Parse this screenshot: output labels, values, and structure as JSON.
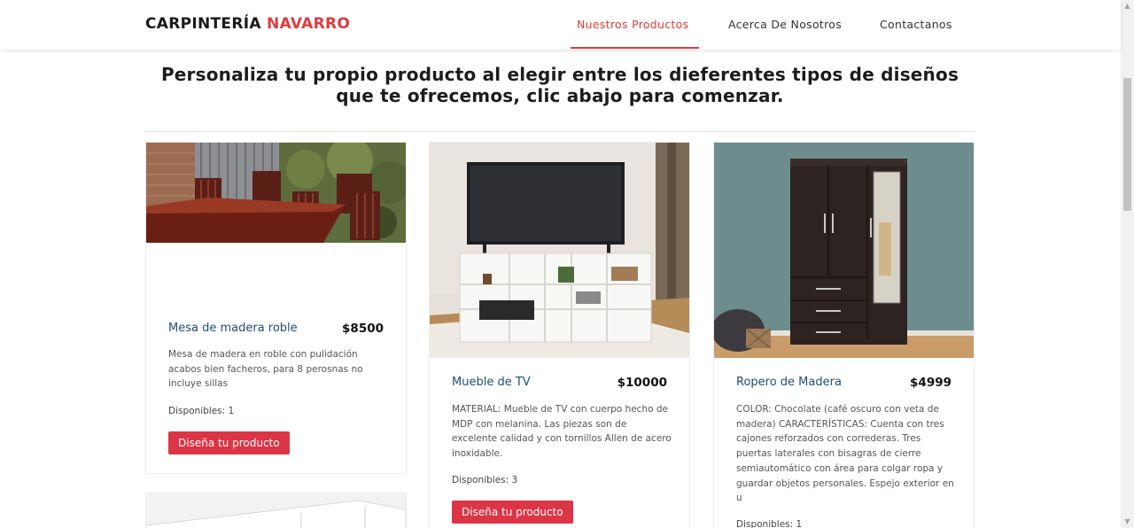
{
  "brand": {
    "name_dark": "CARPINTERÍA",
    "name_accent": "NAVARRO"
  },
  "nav": {
    "items": [
      "Nuestros Productos",
      "Acerca De Nosotros",
      "Contactanos"
    ],
    "active_index": 0
  },
  "heading": "Personaliza tu propio producto al elegir entre los dieferentes tipos de diseños que te ofrecemos, clic abajo para comenzar.",
  "products": [
    {
      "title": "Mesa de madera roble",
      "price": "$8500",
      "description": "Mesa de madera en roble con pulidación acabos bien facheros, para 8 perosnas no incluye sillas",
      "stock": "Disponibles: 1",
      "button": "Diseña tu producto",
      "image": "wooden-dining-table-photo"
    },
    {
      "title": "Mueble de TV",
      "price": "$10000",
      "description": "MATERIAL: Mueble de TV con cuerpo hecho de MDP con melanina. Las piezas son de excelente calidad y con tornillos Allen de acero inoxidable.",
      "stock": "Disponibles: 3",
      "button": "Diseña tu producto",
      "image": "white-tv-stand-photo"
    },
    {
      "title": "Ropero de Madera",
      "price": "$4999",
      "description": "COLOR: Chocolate (café oscuro con veta de madera) CARACTERÍSTICAS: Cuenta con tres cajones reforzados con correderas. Tres puertas laterales con bisagras de cierre semiautomático con área para colgar ropa y guardar objetos personales. Espejo exterior en u",
      "stock": "Disponibles: 1",
      "button": "Diseña tu producto",
      "image": "wooden-wardrobe-photo"
    }
  ],
  "colors": {
    "accent": "#e03a3e",
    "button": "#dc3545",
    "title": "#1f4e78"
  }
}
